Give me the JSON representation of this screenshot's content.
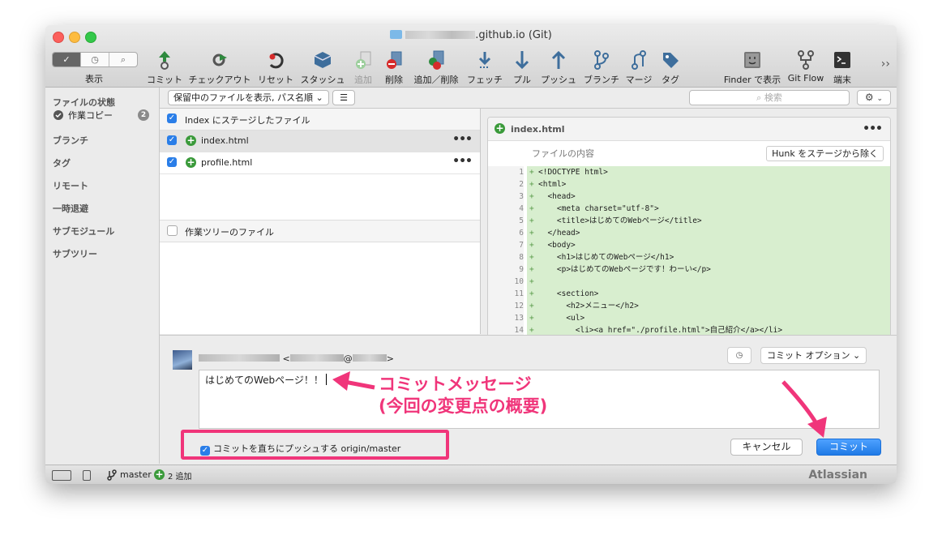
{
  "window": {
    "title": ".github.io (Git)"
  },
  "view": {
    "label": "表示",
    "segments": [
      "✓",
      "◷",
      "⌕"
    ]
  },
  "toolbar": [
    {
      "label": "コミット",
      "icon": "commit-icon"
    },
    {
      "label": "チェックアウト",
      "icon": "checkout-icon"
    },
    {
      "label": "リセット",
      "icon": "reset-icon"
    },
    {
      "label": "スタッシュ",
      "icon": "stash-icon"
    },
    {
      "label": "追加",
      "icon": "add-icon"
    },
    {
      "label": "削除",
      "icon": "remove-icon"
    },
    {
      "label": "追加／削除",
      "icon": "add-remove-icon"
    },
    {
      "label": "フェッチ",
      "icon": "fetch-icon"
    },
    {
      "label": "プル",
      "icon": "pull-icon"
    },
    {
      "label": "プッシュ",
      "icon": "push-icon"
    },
    {
      "label": "ブランチ",
      "icon": "branch-icon"
    },
    {
      "label": "マージ",
      "icon": "merge-icon"
    },
    {
      "label": "タグ",
      "icon": "tag-icon"
    },
    {
      "label": "Finder で表示",
      "icon": "finder-icon"
    },
    {
      "label": "Git Flow",
      "icon": "git-flow-icon"
    },
    {
      "label": "端末",
      "icon": "terminal-icon"
    }
  ],
  "sidebar": {
    "file_status": "ファイルの状態",
    "working_copy": "作業コピー",
    "working_copy_count": "2",
    "sections": [
      "ブランチ",
      "タグ",
      "リモート",
      "一時退避",
      "サブモジュール",
      "サブツリー"
    ]
  },
  "filter": {
    "select_value": "保留中のファイルを表示, パス名順",
    "search_placeholder": "検索"
  },
  "staged": {
    "header": "Index にステージしたファイル",
    "files": [
      "index.html",
      "profile.html"
    ]
  },
  "unstaged": {
    "header": "作業ツリーのファイル"
  },
  "diff": {
    "filename": "index.html",
    "content_label": "ファイルの内容",
    "unstage_button": "Hunk をステージから除く",
    "lines": [
      {
        "n": "1",
        "t": "<!DOCTYPE html>"
      },
      {
        "n": "2",
        "t": "<html>"
      },
      {
        "n": "3",
        "t": "  <head>"
      },
      {
        "n": "4",
        "t": "    <meta charset=\"utf-8\">"
      },
      {
        "n": "5",
        "t": "    <title>はじめてのWebページ</title>"
      },
      {
        "n": "6",
        "t": "  </head>"
      },
      {
        "n": "7",
        "t": "  <body>"
      },
      {
        "n": "8",
        "t": "    <h1>はじめてのWebページ</h1>"
      },
      {
        "n": "9",
        "t": "    <p>はじめてのWebページです！わーい</p>"
      },
      {
        "n": "10",
        "t": ""
      },
      {
        "n": "11",
        "t": "    <section>"
      },
      {
        "n": "12",
        "t": "      <h2>メニュー</h2>"
      },
      {
        "n": "13",
        "t": "      <ul>"
      },
      {
        "n": "14",
        "t": "        <li><a href=\"./profile.html\">自己紹介</a></li>"
      }
    ]
  },
  "commit": {
    "author_suffix": "@",
    "options_label": "コミット オプション",
    "message": "はじめてのWebページ！！",
    "push_label": "コミットを直ちにプッシュする origin/master",
    "cancel_label": "キャンセル",
    "commit_label": "コミット"
  },
  "status": {
    "branch": "master",
    "added": "2 追加",
    "brand": "Atlassian"
  },
  "annotations": {
    "line1": "コミットメッセージ",
    "line2": "(今回の変更点の概要)"
  },
  "colors": {
    "accent": "#f0357a",
    "diff_add": "#d8eecf",
    "commit_button": "#1f7ae6"
  }
}
